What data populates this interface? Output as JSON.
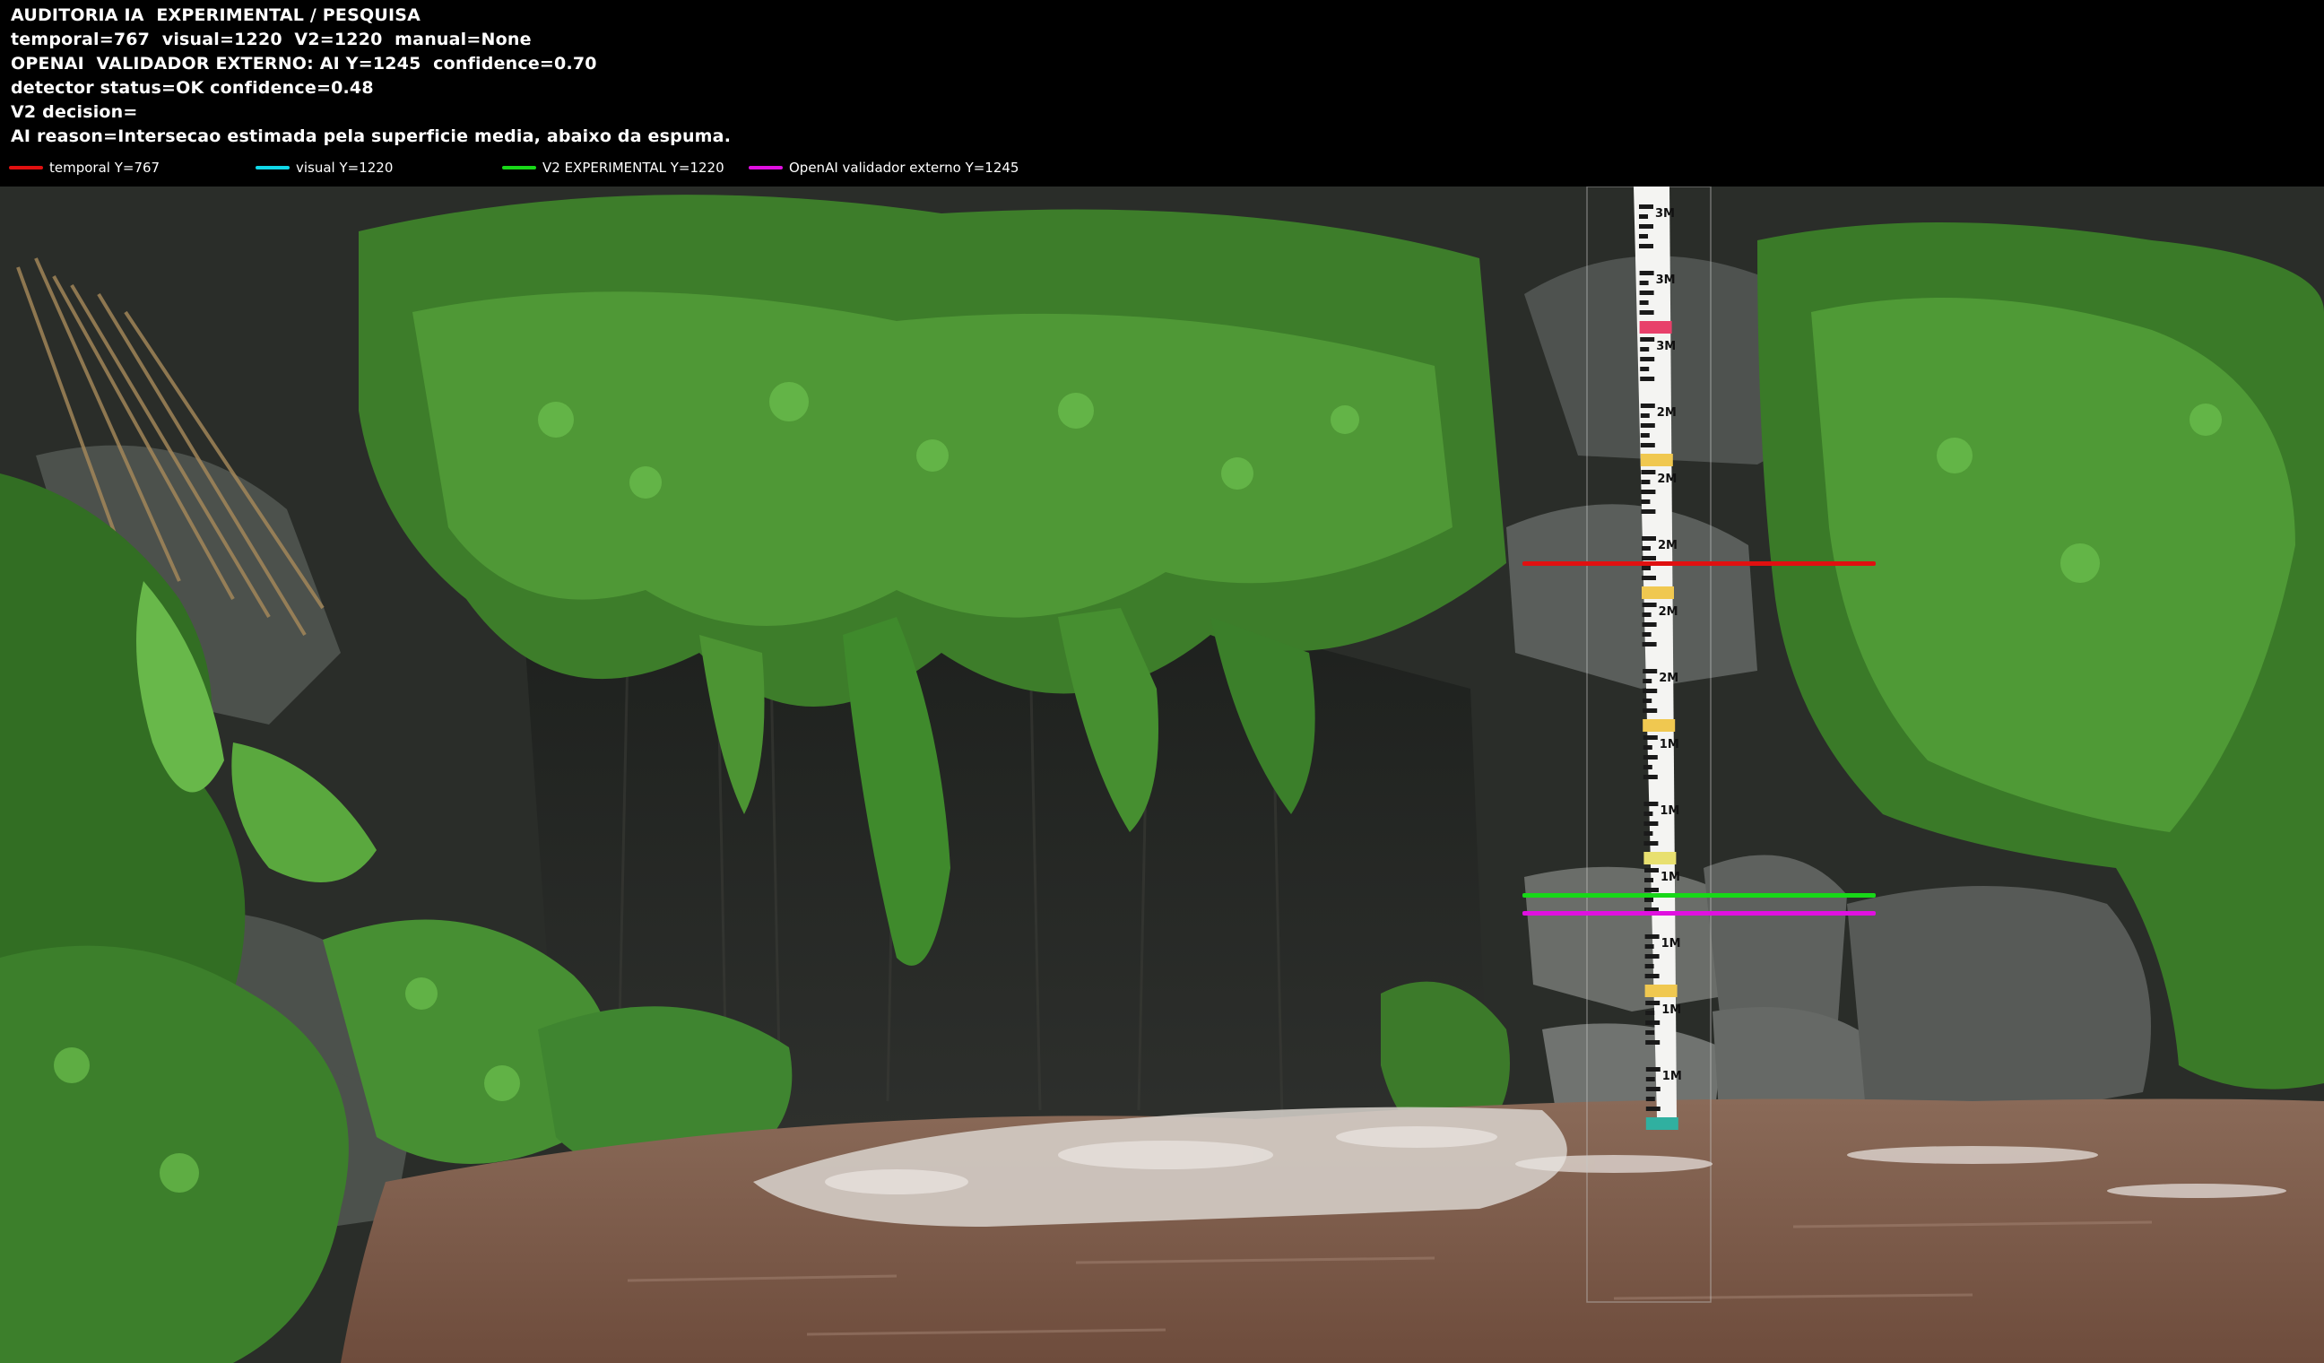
{
  "hud": {
    "lines": [
      "AUDITORIA IA  EXPERIMENTAL / PESQUISA",
      "temporal=767  visual=1220  V2=1220  manual=None",
      "OPENAI  VALIDADOR EXTERNO: AI Y=1245  confidence=0.70",
      "detector status=OK confidence=0.48",
      "V2 decision=",
      "AI reason=Intersecao estimada pela superficie media, abaixo da espuma."
    ]
  },
  "legend": [
    {
      "label": "temporal Y=767",
      "color": "#e01010"
    },
    {
      "label": "visual Y=1220",
      "color": "#10d8e8"
    },
    {
      "label": "V2 EXPERIMENTAL Y=1220",
      "color": "#18d818"
    },
    {
      "label": "OpenAI validador externo Y=1245",
      "color": "#e010e0"
    }
  ],
  "overlay_lines": [
    {
      "name": "temporal-line",
      "color": "#e01010",
      "y_value": 767
    },
    {
      "name": "v2-experimental-line",
      "color": "#18d818",
      "y_value": 1220
    },
    {
      "name": "openai-validator-line",
      "color": "#e010e0",
      "y_value": 1245
    }
  ],
  "gauge": {
    "labels": [
      "3M",
      "3M",
      "3M",
      "2M",
      "2M",
      "2M",
      "2M",
      "2M",
      "1M",
      "1M",
      "1M",
      "1M",
      "1M",
      "1M"
    ]
  }
}
